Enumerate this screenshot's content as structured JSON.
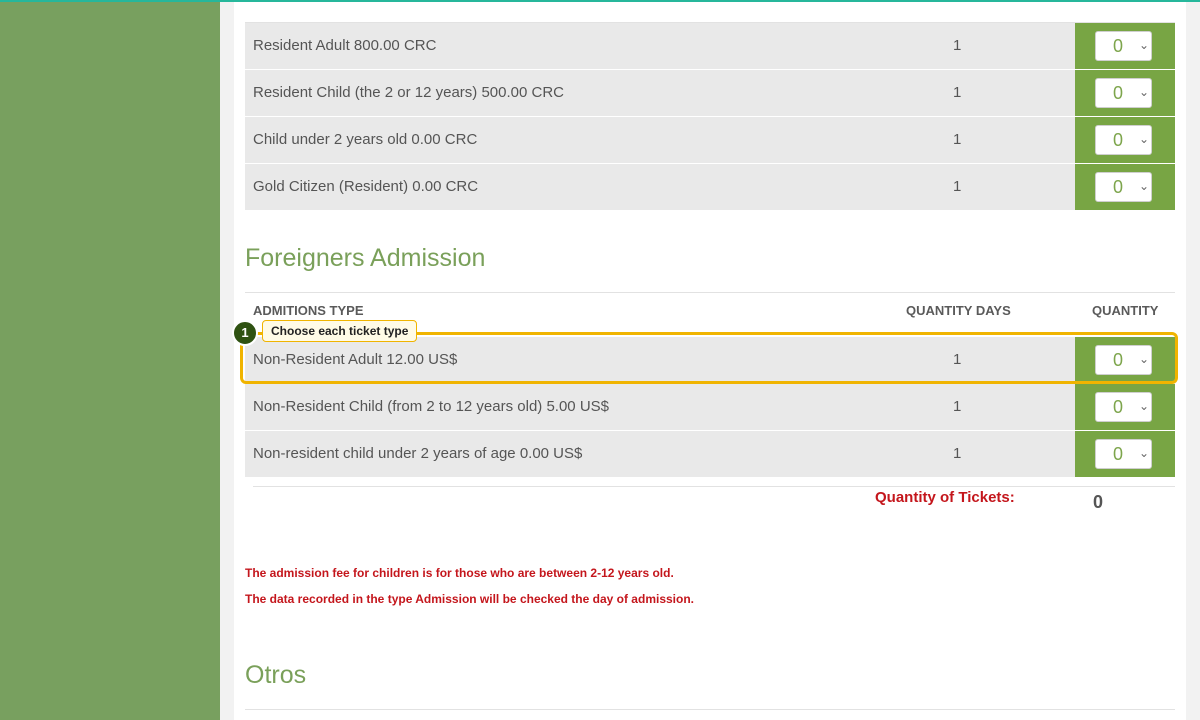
{
  "resident_rows": [
    {
      "label": "Resident Adult 800.00 CRC",
      "days": "1",
      "qty": "0"
    },
    {
      "label": "Resident Child (the 2 or 12 years) 500.00 CRC",
      "days": "1",
      "qty": "0"
    },
    {
      "label": "Child under 2 years old 0.00 CRC",
      "days": "1",
      "qty": "0"
    },
    {
      "label": "Gold Citizen (Resident) 0.00 CRC",
      "days": "1",
      "qty": "0"
    }
  ],
  "foreigners": {
    "title": "Foreigners Admission",
    "headers": {
      "type": "ADMITIONS TYPE",
      "days": "QUANTITY DAYS",
      "qty": "QUANTITY"
    },
    "rows": [
      {
        "label": "Non-Resident Adult 12.00 US$",
        "days": "1",
        "qty": "0"
      },
      {
        "label": "Non-Resident Child (from 2 to 12 years old) 5.00 US$",
        "days": "1",
        "qty": "0"
      },
      {
        "label": "Non-resident child under 2 years of age 0.00 US$",
        "days": "1",
        "qty": "0"
      }
    ]
  },
  "totals": {
    "label": "Quantity of Tickets:",
    "value": "0"
  },
  "notes": [
    "The admission fee for children is for those who are between 2-12 years old.",
    "The data recorded in the type Admission will be checked the day of admission."
  ],
  "otros": {
    "title": "Otros"
  },
  "guide": {
    "step": "1",
    "tooltip": "Choose each ticket type"
  },
  "icons": {
    "select_chevron": "chevron-down-icon"
  },
  "colors": {
    "sidebar": "#78a05f",
    "qty_cell": "#78a544",
    "accent_text": "#c4161c",
    "highlight": "#f0b400",
    "section_title": "#7aa05a"
  }
}
